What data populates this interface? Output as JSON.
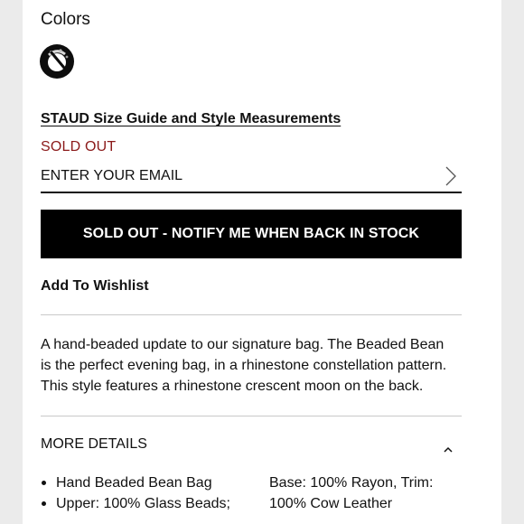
{
  "colors": {
    "label": "Colors",
    "selected_swatch": "black-rhinestone-swatch"
  },
  "size_guide": {
    "link_text": "STAUD Size Guide and Style Measurements"
  },
  "stock": {
    "status": "SOLD OUT",
    "status_color": "#8b1a1a"
  },
  "email": {
    "placeholder": "ENTER YOUR EMAIL",
    "value": ""
  },
  "notify": {
    "button_label": "SOLD OUT - NOTIFY ME WHEN BACK IN STOCK"
  },
  "wishlist": {
    "label": "Add To Wishlist"
  },
  "description": {
    "line1": "A hand-beaded update to our signature bag. The Beaded Bean",
    "line2": "is the perfect evening bag, in a rhinestone constellation pattern.",
    "line3": "This style features a rhinestone crescent moon on the back."
  },
  "more_details": {
    "label": "MORE DETAILS",
    "expanded": true,
    "bullets": [
      "Hand Beaded Bean Bag",
      "Upper: 100% Glass Beads;"
    ],
    "materials": {
      "line1": "Base: 100% Rayon, Trim:",
      "line2": "100% Cow Leather"
    }
  },
  "icons": {
    "submit": "chevron-right-icon",
    "collapse": "chevron-up-icon"
  }
}
